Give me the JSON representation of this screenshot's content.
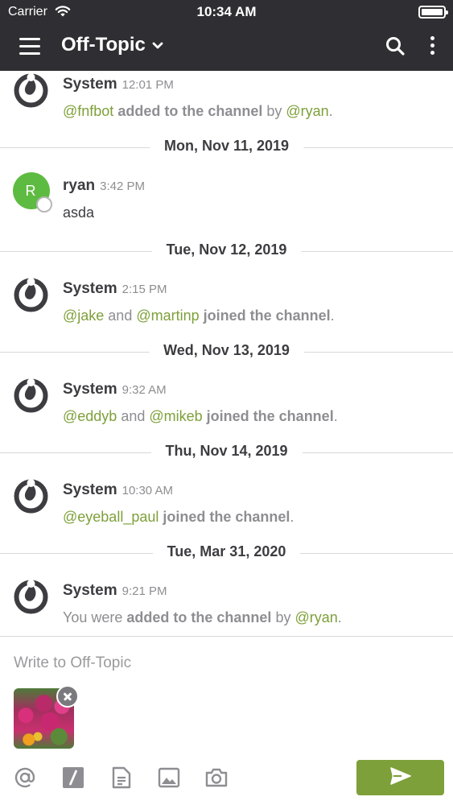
{
  "status_bar": {
    "carrier": "Carrier",
    "time": "10:34 AM"
  },
  "header": {
    "channel_title": "Off-Topic",
    "icons": [
      "menu-icon",
      "chevron-down-icon",
      "search-icon",
      "more-vertical-icon"
    ]
  },
  "feed": {
    "posts": [
      {
        "author": "System",
        "time": "12:01 PM",
        "parts": [
          "@fnfbot",
          " added to the channel",
          " by ",
          "@ryan",
          "."
        ]
      },
      {
        "author": "ryan",
        "avatar_letter": "R",
        "time": "3:42 PM",
        "message": "asda"
      },
      {
        "author": "System",
        "time": "2:15 PM",
        "parts": [
          "@jake",
          " and ",
          "@martinp",
          " joined the channel",
          "."
        ]
      },
      {
        "author": "System",
        "time": "9:32 AM",
        "parts": [
          "@eddyb",
          " and ",
          "@mikeb",
          " joined the channel",
          "."
        ]
      },
      {
        "author": "System",
        "time": "10:30 AM",
        "parts": [
          "@eyeball_paul",
          " joined the channel",
          "."
        ]
      },
      {
        "author": "System",
        "time": "9:21 PM",
        "parts": [
          "You were ",
          "added to the channel",
          " by ",
          "@ryan",
          "."
        ]
      }
    ],
    "date_separators": [
      "Mon, Nov 11, 2019",
      "Tue, Nov 12, 2019",
      "Wed, Nov 13, 2019",
      "Thu, Nov 14, 2019",
      "Tue, Mar 31, 2020"
    ]
  },
  "composer": {
    "placeholder": "Write to Off-Topic",
    "toolbar_icons": [
      "at-mention-icon",
      "slash-command-icon",
      "file-icon",
      "image-icon",
      "camera-icon"
    ],
    "send_icon": "send-icon"
  },
  "colors": {
    "header_bg": "#2f2f33",
    "mention": "#7ea03a",
    "send_button": "#7ea03a",
    "user_avatar": "#5ebb41"
  }
}
